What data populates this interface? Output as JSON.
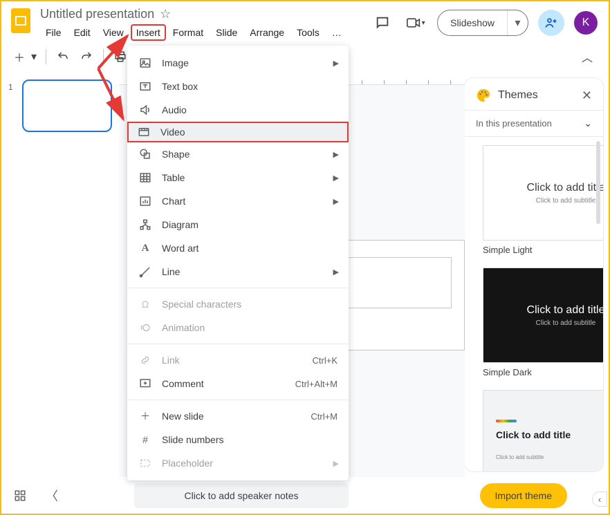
{
  "header": {
    "doc_title": "Untitled presentation",
    "menus": [
      "File",
      "Edit",
      "View",
      "Insert",
      "Format",
      "Slide",
      "Arrange",
      "Tools",
      "…"
    ],
    "slideshow_label": "Slideshow",
    "avatar_letter": "K"
  },
  "filmstrip": {
    "slide_number": "1"
  },
  "insert_menu": {
    "items": [
      {
        "icon": "image",
        "label": "Image",
        "submenu": true
      },
      {
        "icon": "textbox",
        "label": "Text box"
      },
      {
        "icon": "audio",
        "label": "Audio"
      },
      {
        "icon": "video",
        "label": "Video",
        "highlighted": true,
        "row_highlight": true
      },
      {
        "icon": "shape",
        "label": "Shape",
        "submenu": true
      },
      {
        "icon": "table",
        "label": "Table",
        "submenu": true
      },
      {
        "icon": "chart",
        "label": "Chart",
        "submenu": true
      },
      {
        "icon": "diagram",
        "label": "Diagram"
      },
      {
        "icon": "wordart",
        "label": "Word art"
      },
      {
        "icon": "line",
        "label": "Line",
        "submenu": true
      }
    ],
    "sep1": true,
    "disabled_items": [
      {
        "icon": "omega",
        "label": "Special characters"
      },
      {
        "icon": "animation",
        "label": "Animation"
      }
    ],
    "sep2": true,
    "bottom_items": [
      {
        "icon": "link",
        "label": "Link",
        "shortcut": "Ctrl+K",
        "disabled": true
      },
      {
        "icon": "comment",
        "label": "Comment",
        "shortcut": "Ctrl+Alt+M"
      }
    ],
    "sep3": true,
    "final_items": [
      {
        "icon": "plus",
        "label": "New slide",
        "shortcut": "Ctrl+M"
      },
      {
        "icon": "hash",
        "label": "Slide numbers"
      },
      {
        "icon": "placeholder",
        "label": "Placeholder",
        "submenu": true,
        "disabled": true
      }
    ]
  },
  "themes": {
    "title": "Themes",
    "subtitle": "In this presentation",
    "cards": [
      {
        "title": "Click to add title",
        "sub": "Click to add subtitle",
        "name": "Simple Light"
      },
      {
        "title": "Click to add title",
        "sub": "Click to add subtitle",
        "name": "Simple Dark"
      },
      {
        "title": "Click to add title",
        "sub": "Click to add subtitle"
      }
    ],
    "import_label": "Import theme"
  },
  "footer": {
    "speaker_notes": "Click to add speaker notes"
  }
}
